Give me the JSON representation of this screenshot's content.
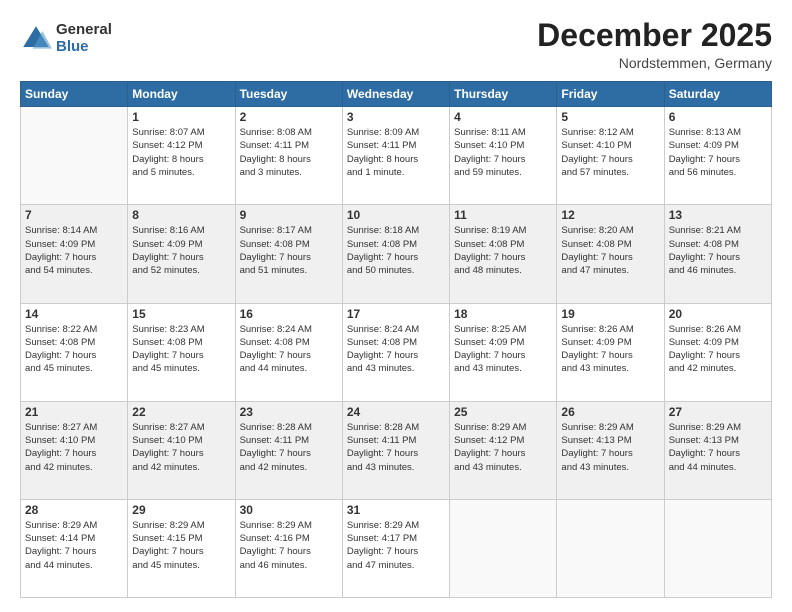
{
  "logo": {
    "general": "General",
    "blue": "Blue"
  },
  "title": "December 2025",
  "subtitle": "Nordstemmen, Germany",
  "days_of_week": [
    "Sunday",
    "Monday",
    "Tuesday",
    "Wednesday",
    "Thursday",
    "Friday",
    "Saturday"
  ],
  "weeks": [
    [
      {
        "day": "",
        "info": ""
      },
      {
        "day": "1",
        "info": "Sunrise: 8:07 AM\nSunset: 4:12 PM\nDaylight: 8 hours\nand 5 minutes."
      },
      {
        "day": "2",
        "info": "Sunrise: 8:08 AM\nSunset: 4:11 PM\nDaylight: 8 hours\nand 3 minutes."
      },
      {
        "day": "3",
        "info": "Sunrise: 8:09 AM\nSunset: 4:11 PM\nDaylight: 8 hours\nand 1 minute."
      },
      {
        "day": "4",
        "info": "Sunrise: 8:11 AM\nSunset: 4:10 PM\nDaylight: 7 hours\nand 59 minutes."
      },
      {
        "day": "5",
        "info": "Sunrise: 8:12 AM\nSunset: 4:10 PM\nDaylight: 7 hours\nand 57 minutes."
      },
      {
        "day": "6",
        "info": "Sunrise: 8:13 AM\nSunset: 4:09 PM\nDaylight: 7 hours\nand 56 minutes."
      }
    ],
    [
      {
        "day": "7",
        "info": "Sunrise: 8:14 AM\nSunset: 4:09 PM\nDaylight: 7 hours\nand 54 minutes."
      },
      {
        "day": "8",
        "info": "Sunrise: 8:16 AM\nSunset: 4:09 PM\nDaylight: 7 hours\nand 52 minutes."
      },
      {
        "day": "9",
        "info": "Sunrise: 8:17 AM\nSunset: 4:08 PM\nDaylight: 7 hours\nand 51 minutes."
      },
      {
        "day": "10",
        "info": "Sunrise: 8:18 AM\nSunset: 4:08 PM\nDaylight: 7 hours\nand 50 minutes."
      },
      {
        "day": "11",
        "info": "Sunrise: 8:19 AM\nSunset: 4:08 PM\nDaylight: 7 hours\nand 48 minutes."
      },
      {
        "day": "12",
        "info": "Sunrise: 8:20 AM\nSunset: 4:08 PM\nDaylight: 7 hours\nand 47 minutes."
      },
      {
        "day": "13",
        "info": "Sunrise: 8:21 AM\nSunset: 4:08 PM\nDaylight: 7 hours\nand 46 minutes."
      }
    ],
    [
      {
        "day": "14",
        "info": "Sunrise: 8:22 AM\nSunset: 4:08 PM\nDaylight: 7 hours\nand 45 minutes."
      },
      {
        "day": "15",
        "info": "Sunrise: 8:23 AM\nSunset: 4:08 PM\nDaylight: 7 hours\nand 45 minutes."
      },
      {
        "day": "16",
        "info": "Sunrise: 8:24 AM\nSunset: 4:08 PM\nDaylight: 7 hours\nand 44 minutes."
      },
      {
        "day": "17",
        "info": "Sunrise: 8:24 AM\nSunset: 4:08 PM\nDaylight: 7 hours\nand 43 minutes."
      },
      {
        "day": "18",
        "info": "Sunrise: 8:25 AM\nSunset: 4:09 PM\nDaylight: 7 hours\nand 43 minutes."
      },
      {
        "day": "19",
        "info": "Sunrise: 8:26 AM\nSunset: 4:09 PM\nDaylight: 7 hours\nand 43 minutes."
      },
      {
        "day": "20",
        "info": "Sunrise: 8:26 AM\nSunset: 4:09 PM\nDaylight: 7 hours\nand 42 minutes."
      }
    ],
    [
      {
        "day": "21",
        "info": "Sunrise: 8:27 AM\nSunset: 4:10 PM\nDaylight: 7 hours\nand 42 minutes."
      },
      {
        "day": "22",
        "info": "Sunrise: 8:27 AM\nSunset: 4:10 PM\nDaylight: 7 hours\nand 42 minutes."
      },
      {
        "day": "23",
        "info": "Sunrise: 8:28 AM\nSunset: 4:11 PM\nDaylight: 7 hours\nand 42 minutes."
      },
      {
        "day": "24",
        "info": "Sunrise: 8:28 AM\nSunset: 4:11 PM\nDaylight: 7 hours\nand 43 minutes."
      },
      {
        "day": "25",
        "info": "Sunrise: 8:29 AM\nSunset: 4:12 PM\nDaylight: 7 hours\nand 43 minutes."
      },
      {
        "day": "26",
        "info": "Sunrise: 8:29 AM\nSunset: 4:13 PM\nDaylight: 7 hours\nand 43 minutes."
      },
      {
        "day": "27",
        "info": "Sunrise: 8:29 AM\nSunset: 4:13 PM\nDaylight: 7 hours\nand 44 minutes."
      }
    ],
    [
      {
        "day": "28",
        "info": "Sunrise: 8:29 AM\nSunset: 4:14 PM\nDaylight: 7 hours\nand 44 minutes."
      },
      {
        "day": "29",
        "info": "Sunrise: 8:29 AM\nSunset: 4:15 PM\nDaylight: 7 hours\nand 45 minutes."
      },
      {
        "day": "30",
        "info": "Sunrise: 8:29 AM\nSunset: 4:16 PM\nDaylight: 7 hours\nand 46 minutes."
      },
      {
        "day": "31",
        "info": "Sunrise: 8:29 AM\nSunset: 4:17 PM\nDaylight: 7 hours\nand 47 minutes."
      },
      {
        "day": "",
        "info": ""
      },
      {
        "day": "",
        "info": ""
      },
      {
        "day": "",
        "info": ""
      }
    ]
  ]
}
